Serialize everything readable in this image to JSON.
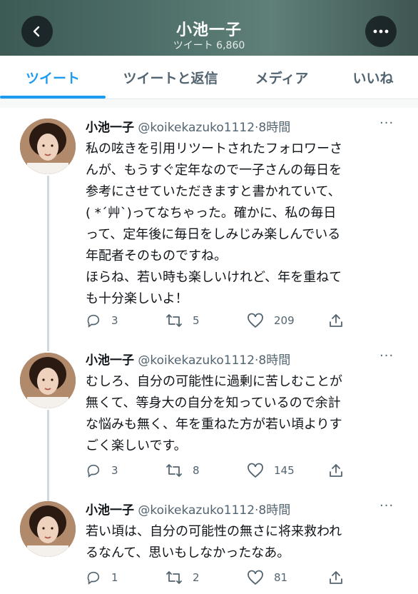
{
  "header": {
    "title": "小池一子",
    "tweet_count": "ツイート 6,860"
  },
  "tabs": [
    {
      "label": "ツイート",
      "active": true
    },
    {
      "label": "ツイートと返信",
      "active": false
    },
    {
      "label": "メディア",
      "active": false
    },
    {
      "label": "いいね",
      "active": false
    }
  ],
  "tweets": [
    {
      "name": "小池一子",
      "handle": "@koikekazuko1112",
      "time": "·8時間",
      "text": "私の呟きを引用リツートされたフォロワーさ\nんが、もうすぐ定年なので一子さんの毎日を\n参考にさせていただきますと書かれていて、\n( *´艸`)ってなちゃった。確かに、私の毎日\nって、定年後に毎日をしみじみ楽しんでいる\n年配者そのものですね。\nほらね、若い時も楽しいけれど、年を重ねて\nも十分楽しいよ！",
      "replies": "3",
      "retweets": "5",
      "likes": "209"
    },
    {
      "name": "小池一子",
      "handle": "@koikekazuko1112",
      "time": "·8時間",
      "text": "むしろ、自分の可能性に過剰に苦しむことが\n無くて、等身大の自分を知っているので余計\nな悩みも無く、年を重ねた方が若い頃よりす\nごく楽しいです。",
      "replies": "3",
      "retweets": "8",
      "likes": "145"
    },
    {
      "name": "小池一子",
      "handle": "@koikekazuko1112",
      "time": "·8時間",
      "text": "若い頃は、自分の可能性の無さに将来救われ\nるなんて、思いもしなかったなあ。",
      "replies": "1",
      "retweets": "2",
      "likes": "81"
    }
  ],
  "colors": {
    "accent": "#1d9bf0",
    "muted": "#536471",
    "thread": "#cfd9de"
  },
  "icons": [
    "back-arrow-icon",
    "more-icon",
    "reply-icon",
    "retweet-icon",
    "like-icon",
    "share-icon"
  ]
}
